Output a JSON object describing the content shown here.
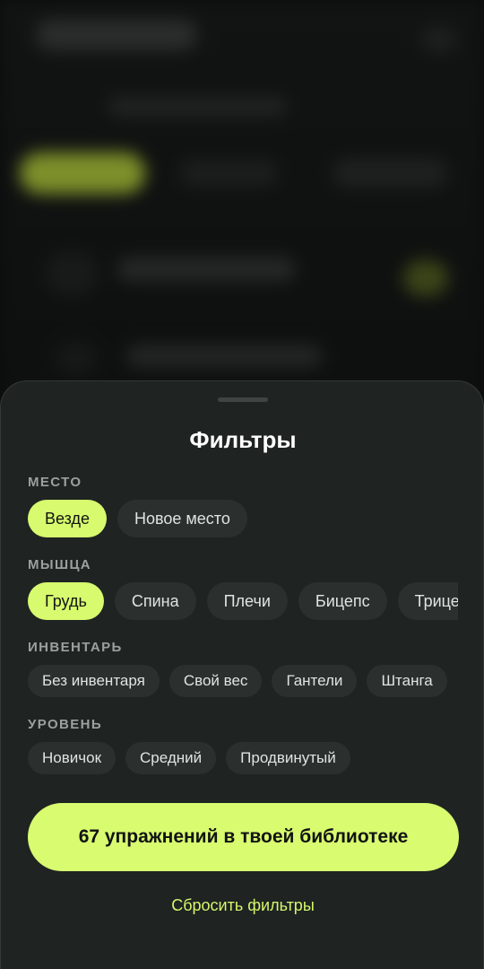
{
  "sheet": {
    "title": "Фильтры",
    "sections": {
      "place": {
        "label": "МЕСТО",
        "chips": [
          {
            "label": "Везде",
            "active": true
          },
          {
            "label": "Новое место",
            "active": false
          }
        ]
      },
      "muscle": {
        "label": "МЫШЦА",
        "chips": [
          {
            "label": "Грудь",
            "active": true
          },
          {
            "label": "Спина",
            "active": false
          },
          {
            "label": "Плечи",
            "active": false
          },
          {
            "label": "Бицепс",
            "active": false
          },
          {
            "label": "Трицепс",
            "active": false
          }
        ]
      },
      "equipment": {
        "label": "ИНВЕНТАРЬ",
        "chips": [
          {
            "label": "Без инвентаря",
            "active": false
          },
          {
            "label": "Свой вес",
            "active": false
          },
          {
            "label": "Гантели",
            "active": false
          },
          {
            "label": "Штанга",
            "active": false
          }
        ]
      },
      "level": {
        "label": "УРОВЕНЬ",
        "chips": [
          {
            "label": "Новичок",
            "active": false
          },
          {
            "label": "Средний",
            "active": false
          },
          {
            "label": "Продвинутый",
            "active": false
          }
        ]
      }
    },
    "cta_label": "67 упражнений в твоей библиотеке",
    "reset_label": "Сбросить фильтры"
  },
  "colors": {
    "accent": "#d7fa6e",
    "sheet_bg": "#1f2322",
    "chip_bg": "#2b302f"
  }
}
